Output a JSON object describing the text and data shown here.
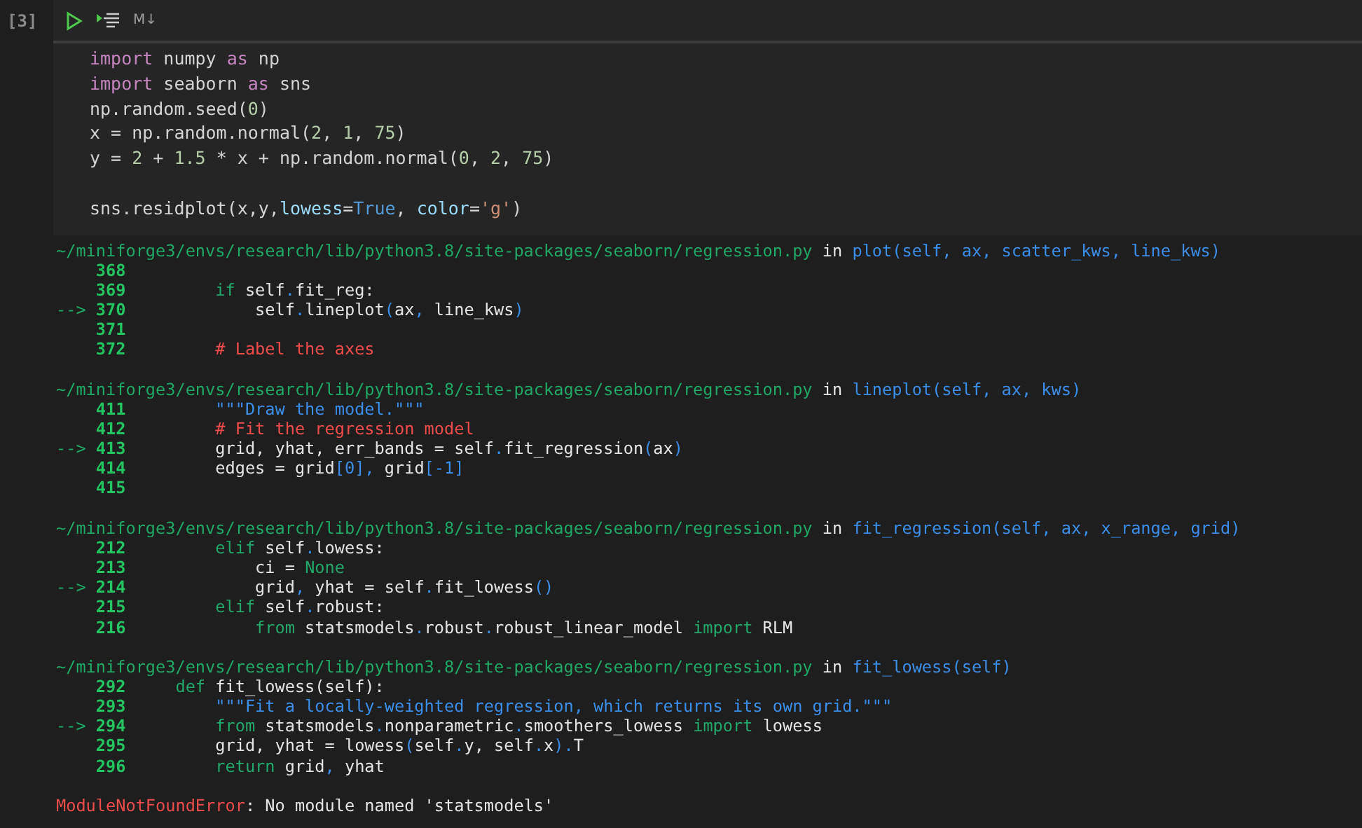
{
  "cell": {
    "execution_count": "[3]",
    "toolbar": {
      "markdown_label": "M↓"
    },
    "lines": [
      {
        "tokens": [
          {
            "text": "import",
            "kind": "kw"
          },
          {
            "text": " numpy ",
            "kind": "text"
          },
          {
            "text": "as",
            "kind": "kw"
          },
          {
            "text": " np",
            "kind": "text"
          }
        ]
      },
      {
        "tokens": [
          {
            "text": "import",
            "kind": "kw"
          },
          {
            "text": " seaborn ",
            "kind": "text"
          },
          {
            "text": "as",
            "kind": "kw"
          },
          {
            "text": " sns",
            "kind": "text"
          }
        ]
      },
      {
        "tokens": [
          {
            "text": "np.random.seed(",
            "kind": "text"
          },
          {
            "text": "0",
            "kind": "num"
          },
          {
            "text": ")",
            "kind": "text"
          }
        ]
      },
      {
        "tokens": [
          {
            "text": "x = np.random.normal(",
            "kind": "text"
          },
          {
            "text": "2",
            "kind": "num"
          },
          {
            "text": ", ",
            "kind": "text"
          },
          {
            "text": "1",
            "kind": "num"
          },
          {
            "text": ", ",
            "kind": "text"
          },
          {
            "text": "75",
            "kind": "num"
          },
          {
            "text": ")",
            "kind": "text"
          }
        ]
      },
      {
        "tokens": [
          {
            "text": "y = ",
            "kind": "text"
          },
          {
            "text": "2",
            "kind": "num"
          },
          {
            "text": " + ",
            "kind": "text"
          },
          {
            "text": "1.5",
            "kind": "num"
          },
          {
            "text": " * x + np.random.normal(",
            "kind": "text"
          },
          {
            "text": "0",
            "kind": "num"
          },
          {
            "text": ", ",
            "kind": "text"
          },
          {
            "text": "2",
            "kind": "num"
          },
          {
            "text": ", ",
            "kind": "text"
          },
          {
            "text": "75",
            "kind": "num"
          },
          {
            "text": ")",
            "kind": "text"
          }
        ]
      },
      {
        "blank_before": true,
        "tokens": [
          {
            "text": "sns.residplot(x,y,",
            "kind": "text"
          },
          {
            "text": "lowess",
            "kind": "param"
          },
          {
            "text": "=",
            "kind": "text"
          },
          {
            "text": "True",
            "kind": "const"
          },
          {
            "text": ", ",
            "kind": "text"
          },
          {
            "text": "color",
            "kind": "param"
          },
          {
            "text": "=",
            "kind": "text"
          },
          {
            "text": "'g'",
            "kind": "str"
          },
          {
            "text": ")",
            "kind": "text"
          }
        ]
      }
    ]
  },
  "traceback": {
    "frames": [
      {
        "path": "~/miniforge3/envs/research/lib/python3.8/site-packages/seaborn/regression.py",
        "in": "in",
        "call": "plot(self, ax, scatter_kws, line_kws)",
        "lines": [
          {
            "number": "368"
          },
          {
            "number": "369",
            "tokens": [
              {
                "text": "        if",
                "kind": "kw"
              },
              {
                "text": " self",
                "kind": "text"
              },
              {
                "text": ".",
                "kind": "punct"
              },
              {
                "text": "fit_reg:",
                "kind": "text"
              }
            ]
          },
          {
            "arrow": "-->",
            "number": "370",
            "tokens": [
              {
                "text": "            self",
                "kind": "text"
              },
              {
                "text": ".",
                "kind": "punct"
              },
              {
                "text": "lineplot",
                "kind": "text"
              },
              {
                "text": "(",
                "kind": "punct"
              },
              {
                "text": "ax",
                "kind": "text"
              },
              {
                "text": ",",
                "kind": "punct"
              },
              {
                "text": " line_kws",
                "kind": "text"
              },
              {
                "text": ")",
                "kind": "punct"
              }
            ]
          },
          {
            "number": "371"
          },
          {
            "number": "372",
            "tokens": [
              {
                "text": "        # Label the axes",
                "kind": "comment"
              }
            ]
          }
        ]
      },
      {
        "path": "~/miniforge3/envs/research/lib/python3.8/site-packages/seaborn/regression.py",
        "in": "in",
        "call": "lineplot(self, ax, kws)",
        "lines": [
          {
            "number": "411",
            "tokens": [
              {
                "text": "        \"\"\"Draw the model.\"\"\"",
                "kind": "doc"
              }
            ]
          },
          {
            "number": "412",
            "tokens": [
              {
                "text": "        # Fit the regression model",
                "kind": "comment"
              }
            ]
          },
          {
            "arrow": "-->",
            "number": "413",
            "tokens": [
              {
                "text": "        grid, yhat, err_bands = self",
                "kind": "text"
              },
              {
                "text": ".",
                "kind": "punct"
              },
              {
                "text": "fit_regression",
                "kind": "text"
              },
              {
                "text": "(",
                "kind": "punct"
              },
              {
                "text": "ax",
                "kind": "text"
              },
              {
                "text": ")",
                "kind": "punct"
              }
            ]
          },
          {
            "number": "414",
            "tokens": [
              {
                "text": "        edges = grid",
                "kind": "text"
              },
              {
                "text": "[0],",
                "kind": "punct"
              },
              {
                "text": " grid",
                "kind": "text"
              },
              {
                "text": "[-1]",
                "kind": "punct"
              }
            ]
          },
          {
            "number": "415"
          }
        ]
      },
      {
        "path": "~/miniforge3/envs/research/lib/python3.8/site-packages/seaborn/regression.py",
        "in": "in",
        "call": "fit_regression(self, ax, x_range, grid)",
        "lines": [
          {
            "number": "212",
            "tokens": [
              {
                "text": "        elif",
                "kind": "kw"
              },
              {
                "text": " self",
                "kind": "text"
              },
              {
                "text": ".",
                "kind": "punct"
              },
              {
                "text": "lowess:",
                "kind": "text"
              }
            ]
          },
          {
            "number": "213",
            "tokens": [
              {
                "text": "            ci = ",
                "kind": "text"
              },
              {
                "text": "None",
                "kind": "kw"
              }
            ]
          },
          {
            "arrow": "-->",
            "number": "214",
            "tokens": [
              {
                "text": "            grid",
                "kind": "text"
              },
              {
                "text": ",",
                "kind": "punct"
              },
              {
                "text": " yhat = self",
                "kind": "text"
              },
              {
                "text": ".",
                "kind": "punct"
              },
              {
                "text": "fit_lowess",
                "kind": "text"
              },
              {
                "text": "()",
                "kind": "punct"
              }
            ]
          },
          {
            "number": "215",
            "tokens": [
              {
                "text": "        elif",
                "kind": "kw"
              },
              {
                "text": " self",
                "kind": "text"
              },
              {
                "text": ".",
                "kind": "punct"
              },
              {
                "text": "robust:",
                "kind": "text"
              }
            ]
          },
          {
            "number": "216",
            "tokens": [
              {
                "text": "            from",
                "kind": "kw"
              },
              {
                "text": " statsmodels",
                "kind": "text"
              },
              {
                "text": ".",
                "kind": "punct"
              },
              {
                "text": "robust",
                "kind": "text"
              },
              {
                "text": ".",
                "kind": "punct"
              },
              {
                "text": "robust_linear_model ",
                "kind": "text"
              },
              {
                "text": "import",
                "kind": "kw"
              },
              {
                "text": " RLM",
                "kind": "text"
              }
            ]
          }
        ]
      },
      {
        "path": "~/miniforge3/envs/research/lib/python3.8/site-packages/seaborn/regression.py",
        "in": "in",
        "call": "fit_lowess(self)",
        "lines": [
          {
            "number": "292",
            "tokens": [
              {
                "text": "    def",
                "kind": "kw"
              },
              {
                "text": " fit_lowess(self):",
                "kind": "text"
              }
            ]
          },
          {
            "number": "293",
            "tokens": [
              {
                "text": "        \"\"\"Fit a locally-weighted regression, which returns its own grid.\"\"\"",
                "kind": "doc"
              }
            ]
          },
          {
            "arrow": "-->",
            "number": "294",
            "tokens": [
              {
                "text": "        from",
                "kind": "kw"
              },
              {
                "text": " statsmodels",
                "kind": "text"
              },
              {
                "text": ".",
                "kind": "punct"
              },
              {
                "text": "nonparametric",
                "kind": "text"
              },
              {
                "text": ".",
                "kind": "punct"
              },
              {
                "text": "smoothers_lowess ",
                "kind": "text"
              },
              {
                "text": "import",
                "kind": "kw"
              },
              {
                "text": " lowess",
                "kind": "text"
              }
            ]
          },
          {
            "number": "295",
            "tokens": [
              {
                "text": "        grid, yhat = lowess",
                "kind": "text"
              },
              {
                "text": "(",
                "kind": "punct"
              },
              {
                "text": "self",
                "kind": "text"
              },
              {
                "text": ".",
                "kind": "punct"
              },
              {
                "text": "y, self",
                "kind": "text"
              },
              {
                "text": ".",
                "kind": "punct"
              },
              {
                "text": "x",
                "kind": "text"
              },
              {
                "text": ").",
                "kind": "punct"
              },
              {
                "text": "T",
                "kind": "text"
              }
            ]
          },
          {
            "number": "296",
            "tokens": [
              {
                "text": "        return",
                "kind": "kw"
              },
              {
                "text": " grid",
                "kind": "text"
              },
              {
                "text": ",",
                "kind": "punct"
              },
              {
                "text": " yhat",
                "kind": "text"
              }
            ]
          }
        ]
      }
    ],
    "error": {
      "name": "ModuleNotFoundError",
      "message": ": No module named 'statsmodels'"
    }
  }
}
